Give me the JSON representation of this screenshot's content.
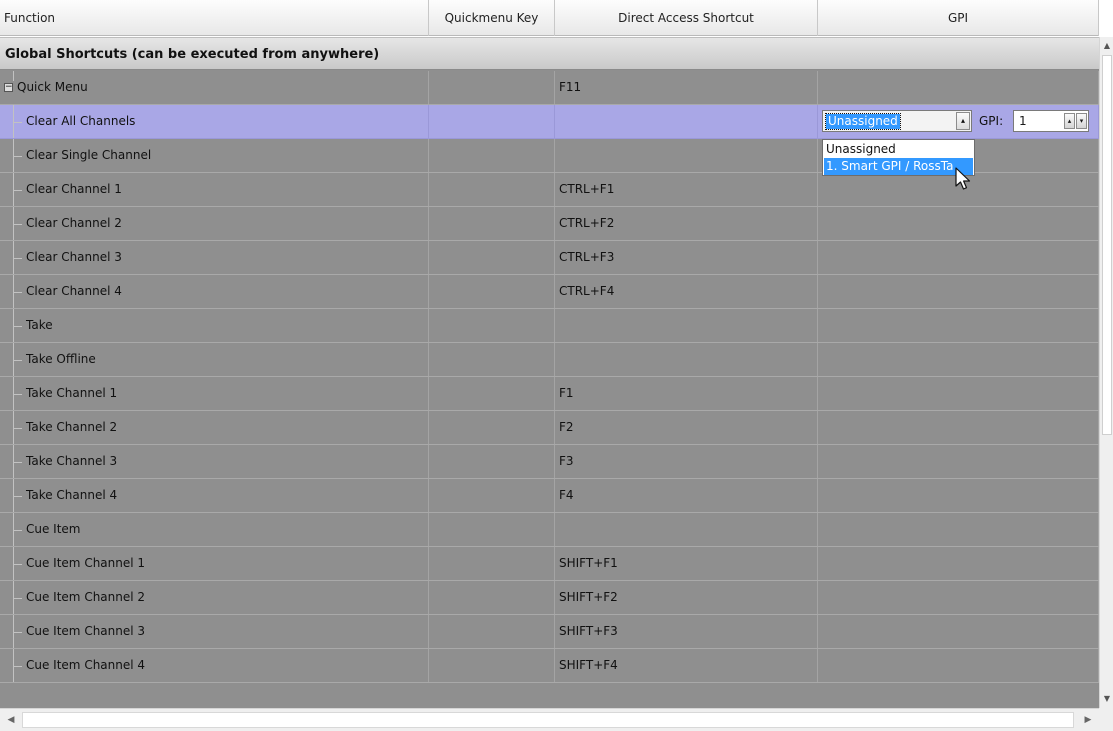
{
  "columns": {
    "function": "Function",
    "quickmenu_key": "Quickmenu Key",
    "direct_access": "Direct Access Shortcut",
    "gpi": "GPI"
  },
  "section_title": "Global Shortcuts (can be executed from anywhere)",
  "root": {
    "expander": "−",
    "label": "Quick Menu",
    "shortcut": "F11"
  },
  "rows": [
    {
      "label": "Clear All Channels",
      "shortcut": ""
    },
    {
      "label": "Clear Single Channel",
      "shortcut": ""
    },
    {
      "label": "Clear Channel 1",
      "shortcut": "CTRL+F1"
    },
    {
      "label": "Clear Channel 2",
      "shortcut": "CTRL+F2"
    },
    {
      "label": "Clear Channel 3",
      "shortcut": "CTRL+F3"
    },
    {
      "label": "Clear Channel 4",
      "shortcut": "CTRL+F4"
    },
    {
      "label": "Take",
      "shortcut": ""
    },
    {
      "label": "Take Offline",
      "shortcut": ""
    },
    {
      "label": "Take Channel 1",
      "shortcut": "F1"
    },
    {
      "label": "Take Channel 2",
      "shortcut": "F2"
    },
    {
      "label": "Take Channel 3",
      "shortcut": "F3"
    },
    {
      "label": "Take Channel 4",
      "shortcut": "F4"
    },
    {
      "label": "Cue Item",
      "shortcut": ""
    },
    {
      "label": "Cue Item Channel 1",
      "shortcut": "SHIFT+F1"
    },
    {
      "label": "Cue Item Channel 2",
      "shortcut": "SHIFT+F2"
    },
    {
      "label": "Cue Item Channel 3",
      "shortcut": "SHIFT+F3"
    },
    {
      "label": "Cue Item Channel 4",
      "shortcut": "SHIFT+F4"
    }
  ],
  "gpi_editor": {
    "combo_value": "Unassigned",
    "gpi_label": "GPI:",
    "gpi_value": "1",
    "dropdown_options": [
      "Unassigned",
      "1. Smart GPI / RossTa"
    ],
    "highlighted_option": "1. Smart GPI / RossTa"
  },
  "icons": {
    "combo_arrow": "▴",
    "spin_up": "▴",
    "spin_down": "▾",
    "scroll_up": "▲",
    "scroll_down": "▼",
    "scroll_left": "◀",
    "scroll_right": "▶"
  },
  "colors": {
    "selected_row": "#a9a7e6",
    "highlight": "#3399ff",
    "grid_bg": "#8f8f8f"
  }
}
